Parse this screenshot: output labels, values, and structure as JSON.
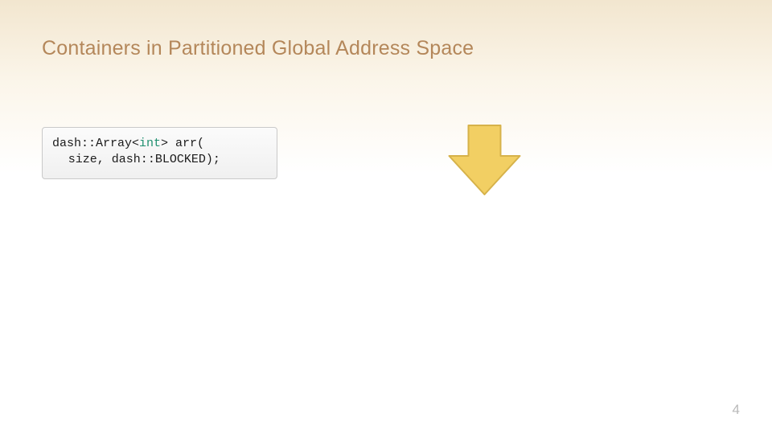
{
  "slide": {
    "title": "Containers in Partitioned Global Address Space",
    "page_number": "4"
  },
  "code": {
    "line1_pre": "dash::Array<",
    "line1_type": "int",
    "line1_post": "> arr(",
    "line2": "size, dash::BLOCKED);"
  },
  "icons": {
    "arrow": "down-arrow-icon"
  },
  "colors": {
    "title": "#b4875a",
    "type_keyword": "#1f8f6f",
    "arrow_fill": "#f2cf63",
    "arrow_stroke": "#d6b24a"
  }
}
